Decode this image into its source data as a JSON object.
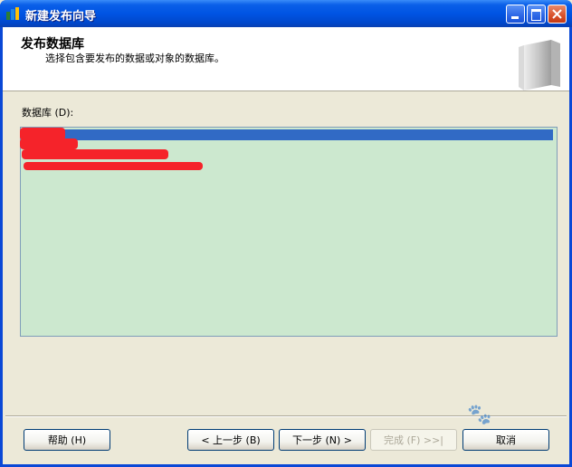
{
  "window": {
    "title": "新建发布向导"
  },
  "header": {
    "title": "发布数据库",
    "subtitle": "选择包含要发布的数据或对象的数据库。"
  },
  "databases": {
    "label": "数据库 (D):",
    "items": [
      "",
      "",
      "",
      ""
    ],
    "selected_index": 0
  },
  "buttons": {
    "help": "帮助 (H)",
    "back": "< 上一步 (B)",
    "next": "下一步 (N) >",
    "finish": "完成 (F) >>|",
    "cancel": "取消"
  },
  "colors": {
    "titlebar": "#0054E3",
    "list_bg": "#CCE8CF",
    "selection": "#316AC5",
    "redaction": "#F5232A"
  }
}
